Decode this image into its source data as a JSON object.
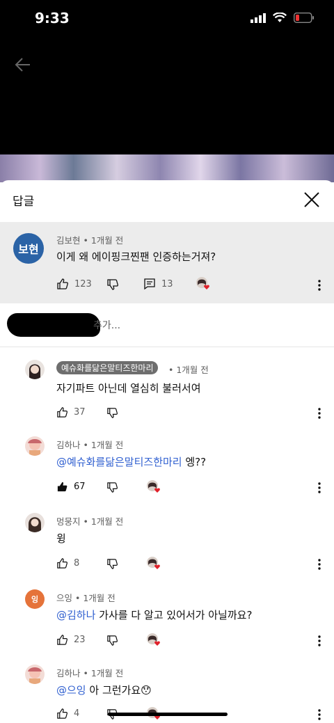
{
  "status": {
    "time": "9:33"
  },
  "sheet": {
    "title": "답글"
  },
  "parent": {
    "avatar_text": "보현",
    "author": "김보현",
    "time": "• 1개월 전",
    "text": "이게 왜 에이핑크찐팬 인증하는거져?",
    "likes": "123",
    "replies": "13"
  },
  "reply_input": {
    "placeholder": "추가..."
  },
  "replies": [
    {
      "author": "예슈화를닮은말티즈한마리",
      "time": "• 1개월 전",
      "mention": "",
      "text": "자기파트 아닌데 열심히 불러서여",
      "likes": "37",
      "liked": false,
      "creator_heart": false
    },
    {
      "author": "김하나",
      "time": "• 1개월 전",
      "mention": "@예슈화를닮은말티즈한마리",
      "text": " 엥??",
      "likes": "67",
      "liked": true,
      "creator_heart": true
    },
    {
      "author": "멍뭉지",
      "time": "• 1개월 전",
      "mention": "",
      "text": "윙",
      "likes": "8",
      "liked": false,
      "creator_heart": true
    },
    {
      "author": "으잉",
      "avatar_text": "잉",
      "time": "• 1개월 전",
      "mention": "@김하나",
      "text": " 가사를 다 알고 있어서가 아닐까요?",
      "likes": "23",
      "liked": false,
      "creator_heart": true
    },
    {
      "author": "김하나",
      "time": "• 1개월 전",
      "mention": "@으잉",
      "text": " 아 그런가요😯",
      "likes": "4",
      "liked": false,
      "creator_heart": true
    }
  ],
  "colors": {
    "mention": "#2f5fd0",
    "avatar_bg": "#2b63a6",
    "heart": "#e0212b",
    "orange_avatar": "#e5733a"
  }
}
